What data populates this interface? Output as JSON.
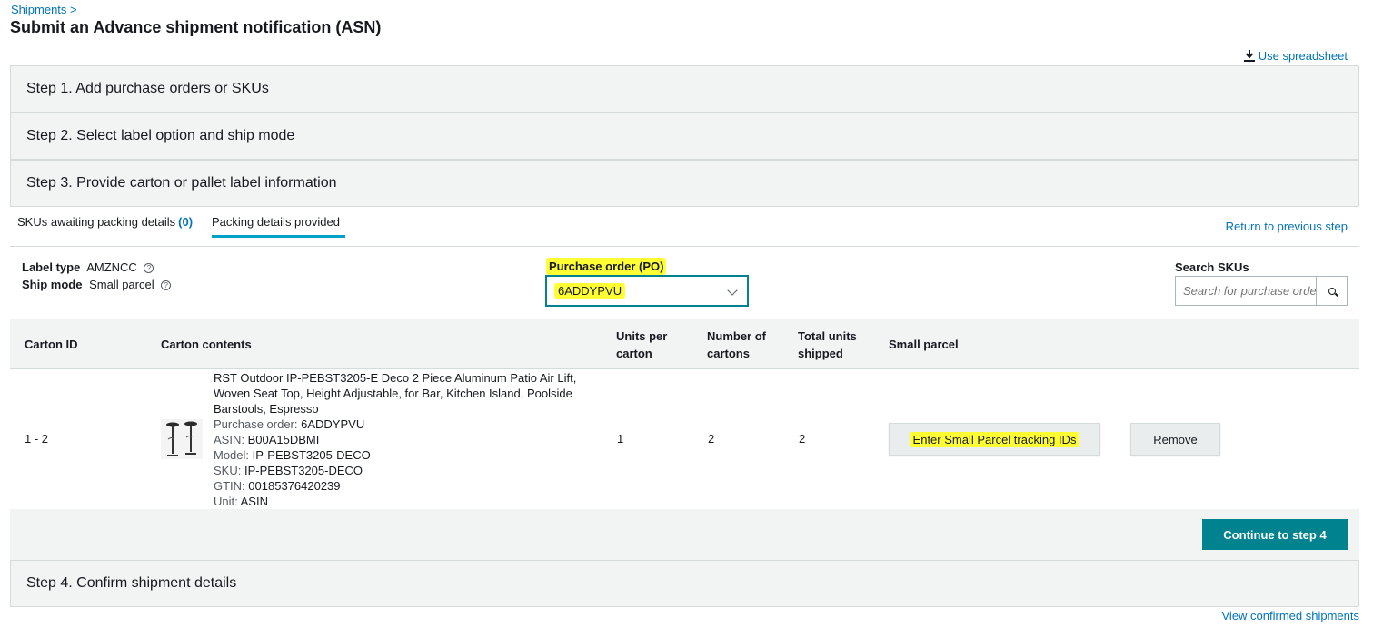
{
  "breadcrumb": "Shipments >",
  "page_title": "Submit an Advance shipment notification (ASN)",
  "use_spreadsheet": "Use spreadsheet",
  "steps": {
    "step1": "Step 1. Add purchase orders or SKUs",
    "step2": "Step 2. Select label option and ship mode",
    "step3": "Step 3. Provide carton or pallet label information",
    "step4": "Step 4. Confirm shipment details"
  },
  "tabs": {
    "awaiting_label": "SKUs awaiting packing details",
    "awaiting_count": "(0)",
    "provided_label": "Packing details provided"
  },
  "return_link": "Return to previous step",
  "label_type": {
    "label": "Label type",
    "value": "AMZNCC"
  },
  "ship_mode": {
    "label": "Ship mode",
    "value": "Small parcel"
  },
  "purchase_order": {
    "label": "Purchase order (PO)",
    "value": "6ADDYPVU"
  },
  "search": {
    "label": "Search SKUs",
    "placeholder": "Search for purchase order"
  },
  "table": {
    "headers": {
      "carton_id": "Carton ID",
      "carton_contents": "Carton contents",
      "units_per_carton_1": "Units per",
      "units_per_carton_2": "carton",
      "number_of_cartons_1": "Number of",
      "number_of_cartons_2": "cartons",
      "total_units_1": "Total units",
      "total_units_2": "shipped",
      "small_parcel": "Small parcel"
    },
    "row": {
      "carton_id": "1 - 2",
      "title_line1": "RST Outdoor IP-PEBST3205-E Deco 2 Piece Aluminum Patio Air Lift,",
      "title_line2": "Woven Seat Top, Height Adjustable, for Bar, Kitchen Island, Poolside",
      "title_line3": "Barstools, Espresso",
      "po_label": "Purchase order:",
      "po_value": "6ADDYPVU",
      "asin_label": "ASIN:",
      "asin_value": "B00A15DBMI",
      "model_label": "Model:",
      "model_value": "IP-PEBST3205-DECO",
      "sku_label": "SKU:",
      "sku_value": "IP-PEBST3205-DECO",
      "gtin_label": "GTIN:",
      "gtin_value": "00185376420239",
      "unit_label": "Unit:",
      "unit_value": "ASIN",
      "units_per_carton": "1",
      "number_of_cartons": "2",
      "total_units": "2",
      "tracking_button": "Enter Small Parcel tracking IDs",
      "remove_button": "Remove"
    }
  },
  "continue_button": "Continue to step 4",
  "view_confirmed": "View confirmed shipments",
  "colors": {
    "link": "#0073bb",
    "primary": "#00838f",
    "highlight": "#ffff33",
    "tab_underline": "#00a1c9"
  }
}
